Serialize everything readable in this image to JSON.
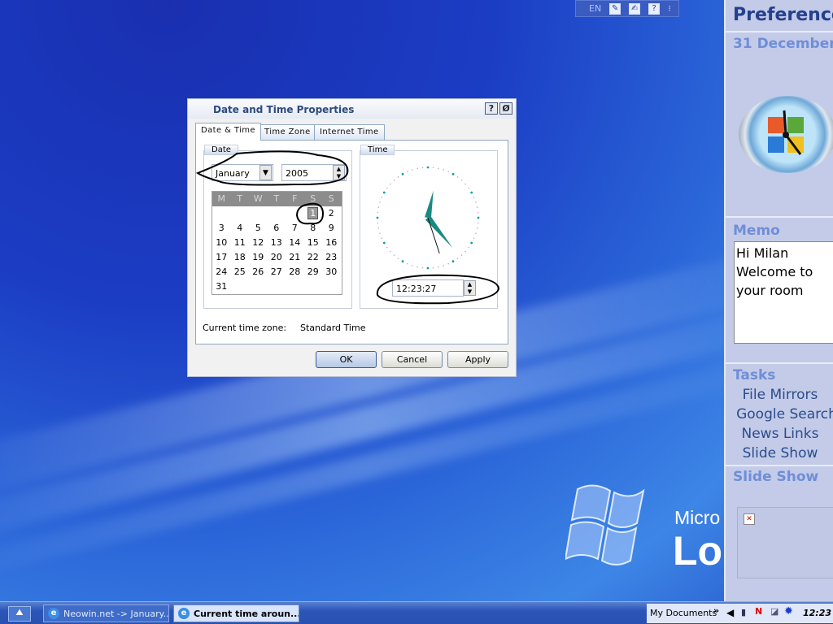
{
  "langbar": {
    "lang": "EN",
    "icons": [
      "pen-icon",
      "handwriting-icon",
      "help-icon",
      "options-icon"
    ]
  },
  "dialog": {
    "title": "Date and Time Properties",
    "help_button": "?",
    "close_button": "Ø",
    "tabs": [
      {
        "label": "Date & Time",
        "active": true
      },
      {
        "label": "Time Zone"
      },
      {
        "label": "Internet Time"
      }
    ],
    "date_group": "Date",
    "month": "January",
    "year": "2005",
    "weekdays": [
      "M",
      "T",
      "W",
      "T",
      "F",
      "S",
      "S"
    ],
    "first_weekday_index": 5,
    "days_in_month": 31,
    "selected_day": 1,
    "time_group": "Time",
    "time": "12:23:27",
    "clock": {
      "hour": 12,
      "minute": 23,
      "second": 27,
      "hand_color": "#1a8a80"
    },
    "timezone_label": "Current time zone:",
    "timezone_value": "Standard Time",
    "ok": "OK",
    "cancel": "Cancel",
    "apply": "Apply"
  },
  "desktop": {
    "brand_line1": "Micro",
    "brand_line2": "Lo"
  },
  "sidebar": {
    "title": "Preference",
    "date": "31 December",
    "memo_title": "Memo",
    "memo_lines": [
      "Hi Milan",
      "Welcome to",
      "your room"
    ],
    "tasks_title": "Tasks",
    "tasks": [
      "File Mirrors",
      "Google Search",
      "News Links",
      "Slide Show"
    ],
    "slideshow_title": "Slide Show"
  },
  "taskbar": {
    "windows": [
      {
        "label": "Neowin.net -> January..."
      },
      {
        "label": "Current time aroun...",
        "active": true
      }
    ],
    "toolbar_label": "My Documents",
    "chevron": "»",
    "clock": "12:23"
  }
}
